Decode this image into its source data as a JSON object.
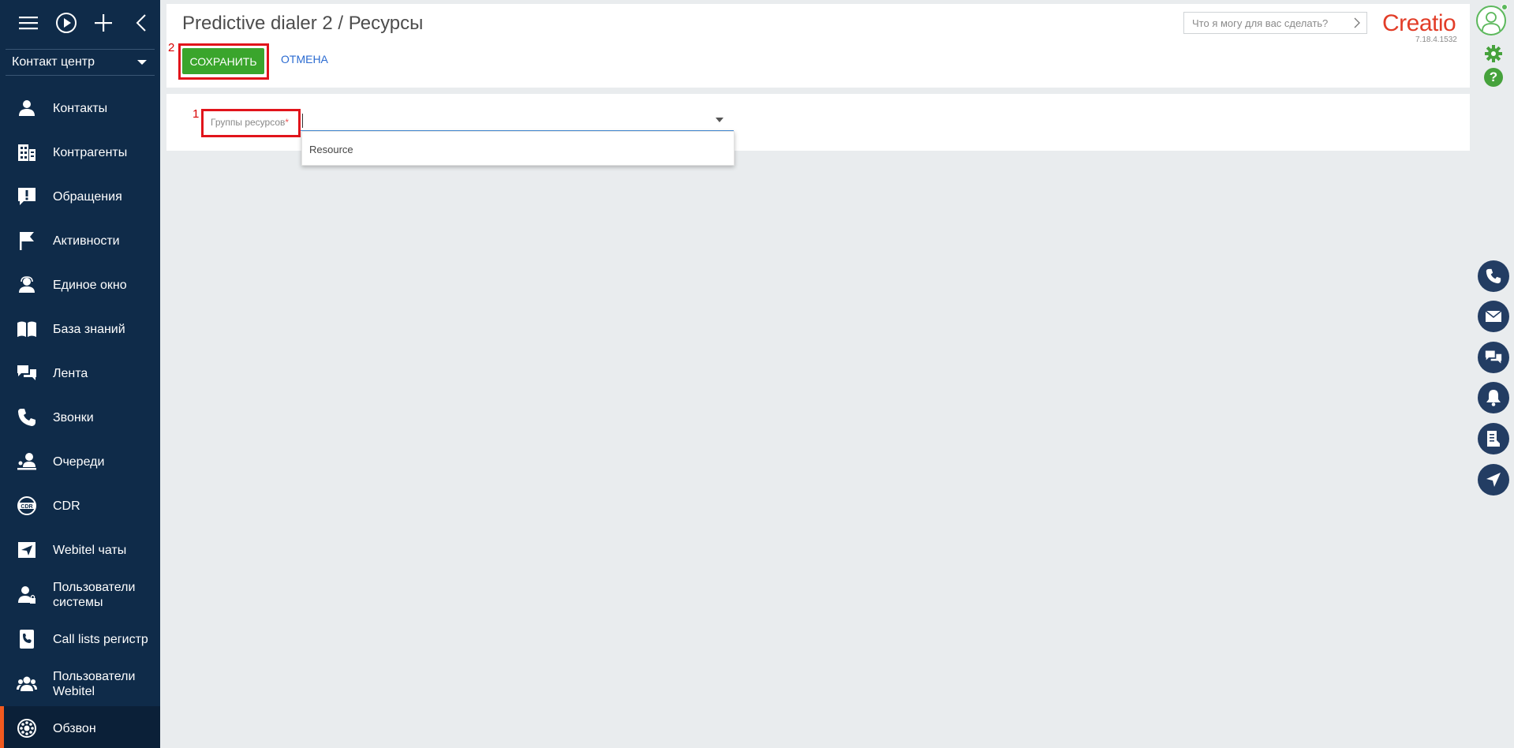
{
  "sidebar": {
    "section": "Контакт центр",
    "items": [
      {
        "label": "Контакты",
        "icon": "person-icon"
      },
      {
        "label": "Контрагенты",
        "icon": "building-icon"
      },
      {
        "label": "Обращения",
        "icon": "exclamation-icon"
      },
      {
        "label": "Активности",
        "icon": "flag-icon"
      },
      {
        "label": "Единое окно",
        "icon": "operator-icon"
      },
      {
        "label": "База знаний",
        "icon": "book-icon"
      },
      {
        "label": "Лента",
        "icon": "chat-bubbles-icon"
      },
      {
        "label": "Звонки",
        "icon": "phone-icon"
      },
      {
        "label": "Очереди",
        "icon": "queue-icon"
      },
      {
        "label": "CDR",
        "icon": "cdr-icon"
      },
      {
        "label": "Webitel чаты",
        "icon": "paper-plane-icon"
      },
      {
        "label": "Пользователи системы",
        "icon": "user-lock-icon"
      },
      {
        "label": "Call lists регистр",
        "icon": "phone-book-icon"
      },
      {
        "label": "Пользователи Webitel",
        "icon": "users-icon"
      },
      {
        "label": "Обзвон",
        "icon": "dial-icon"
      }
    ]
  },
  "header": {
    "title": "Predictive dialer 2 / Ресурсы",
    "save_label": "СОХРАНИТЬ",
    "cancel_label": "ОТМЕНА",
    "search_placeholder": "Что я могу для вас сделать?",
    "logo": "Creatio",
    "version": "7.18.4.1532"
  },
  "markers": {
    "one": "1",
    "two": "2"
  },
  "field": {
    "label": "Группы ресурсов",
    "required": "*",
    "value": "",
    "options": [
      "Resource"
    ]
  },
  "colors": {
    "sidebar": "#0f2b49",
    "accent_save": "#3aa52c",
    "active_marker": "#f25a1f",
    "logo": "#e23d28",
    "highlight": "#e1141b"
  }
}
